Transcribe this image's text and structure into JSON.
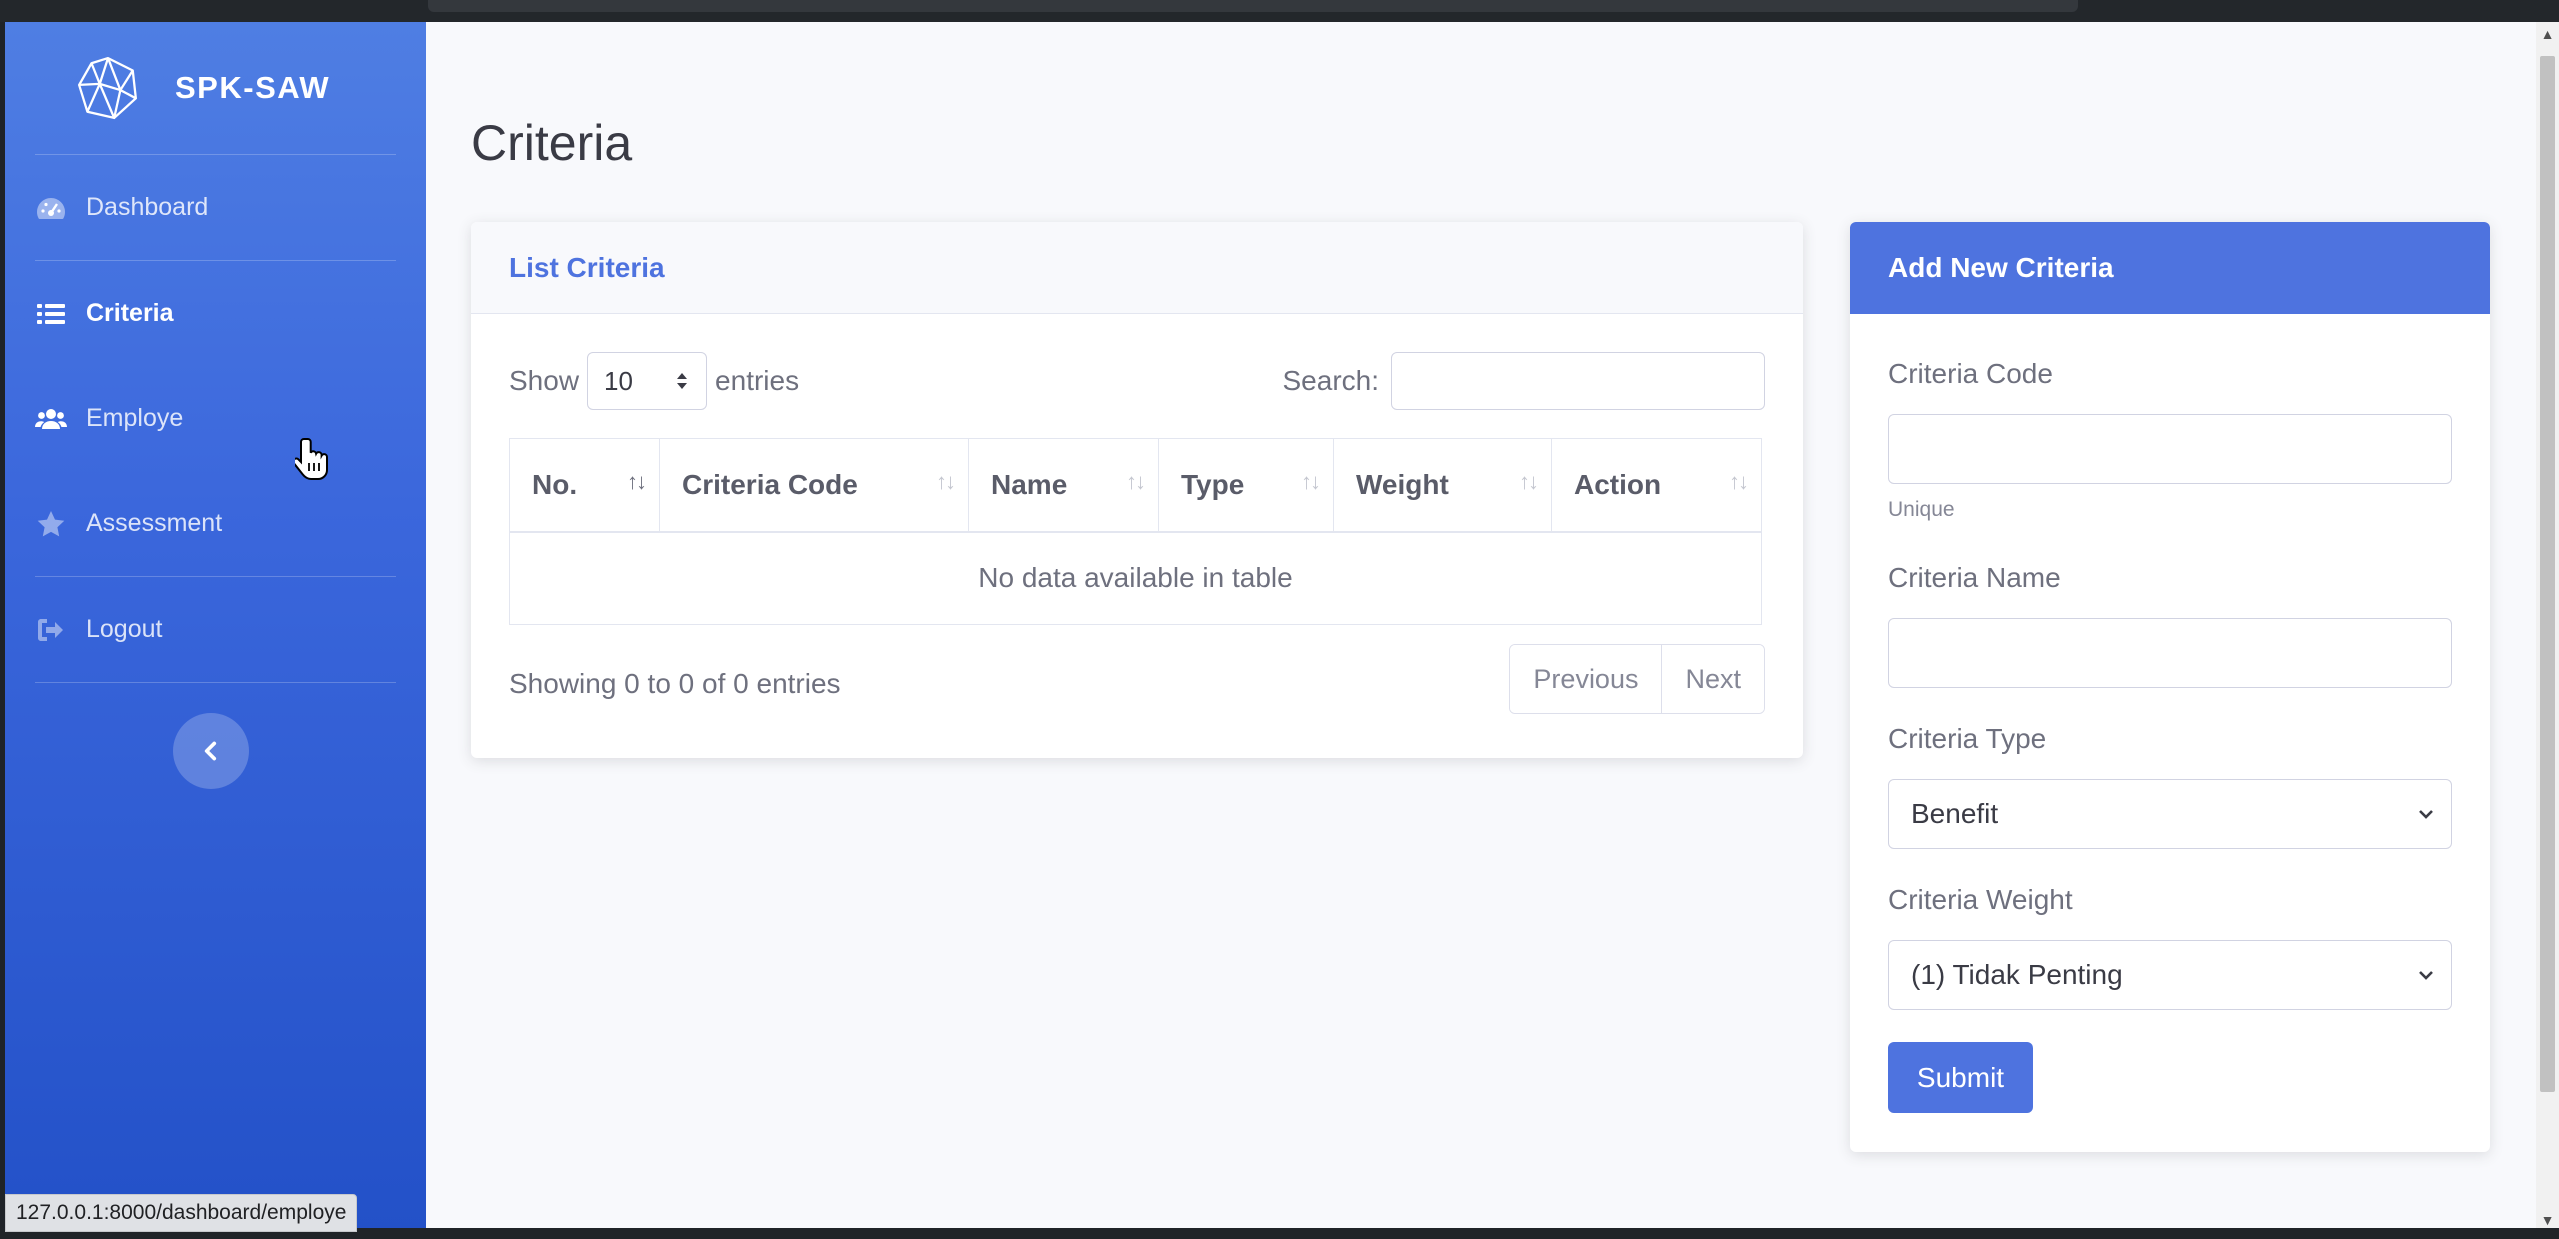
{
  "brand": {
    "name": "SPK-SAW"
  },
  "sidebar": {
    "items": [
      {
        "label": "Dashboard",
        "icon": "tachometer-icon",
        "active": false
      },
      {
        "label": "Criteria",
        "icon": "list-icon",
        "active": true
      },
      {
        "label": "Employe",
        "icon": "users-icon",
        "active": false
      },
      {
        "label": "Assessment",
        "icon": "star-icon",
        "active": false
      },
      {
        "label": "Logout",
        "icon": "sign-out-icon",
        "active": false
      }
    ],
    "toggle_icon": "chevron-left-icon"
  },
  "page": {
    "title": "Criteria"
  },
  "list_card": {
    "title": "List Criteria",
    "show_label": "Show",
    "entries_value": "10",
    "entries_label": "entries",
    "search_label": "Search:",
    "search_value": "",
    "columns": [
      "No.",
      "Criteria Code",
      "Name",
      "Type",
      "Weight",
      "Action"
    ],
    "empty_message": "No data available in table",
    "info": "Showing 0 to 0 of 0 entries",
    "pagination": {
      "previous": "Previous",
      "next": "Next"
    }
  },
  "form_card": {
    "title": "Add New Criteria",
    "code_label": "Criteria Code",
    "code_value": "",
    "code_help": "Unique",
    "name_label": "Criteria Name",
    "name_value": "",
    "type_label": "Criteria Type",
    "type_selected": "Benefit",
    "weight_label": "Criteria Weight",
    "weight_selected": "(1) Tidak Penting",
    "submit_label": "Submit"
  },
  "status_bar": {
    "url": "127.0.0.1:8000/dashboard/employe"
  },
  "colors": {
    "primary": "#4e73df",
    "sidebar_top": "#4f7ee3",
    "sidebar_bottom": "#2351c8",
    "text": "#6e707e"
  }
}
